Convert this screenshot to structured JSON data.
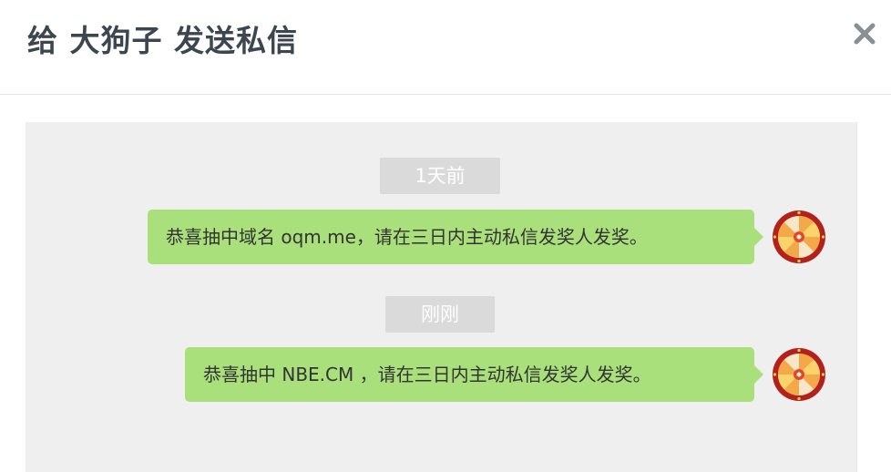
{
  "dialog": {
    "title": "给 大狗子 发送私信",
    "close_icon": "close-icon"
  },
  "messages": [
    {
      "time": "1天前",
      "text": "恭喜抽中域名 oqm.me，请在三日内主动私信发奖人发奖。",
      "avatar_icon": "prize-wheel-avatar"
    },
    {
      "time": "刚刚",
      "text": "恭喜抽中 NBE.CM ，请在三日内主动私信发奖人发奖。",
      "avatar_icon": "prize-wheel-avatar"
    }
  ],
  "colors": {
    "bubble": "#a9e07b",
    "chat_background": "#efefef",
    "time_badge": "#dadada",
    "title_text": "#3c4550"
  }
}
